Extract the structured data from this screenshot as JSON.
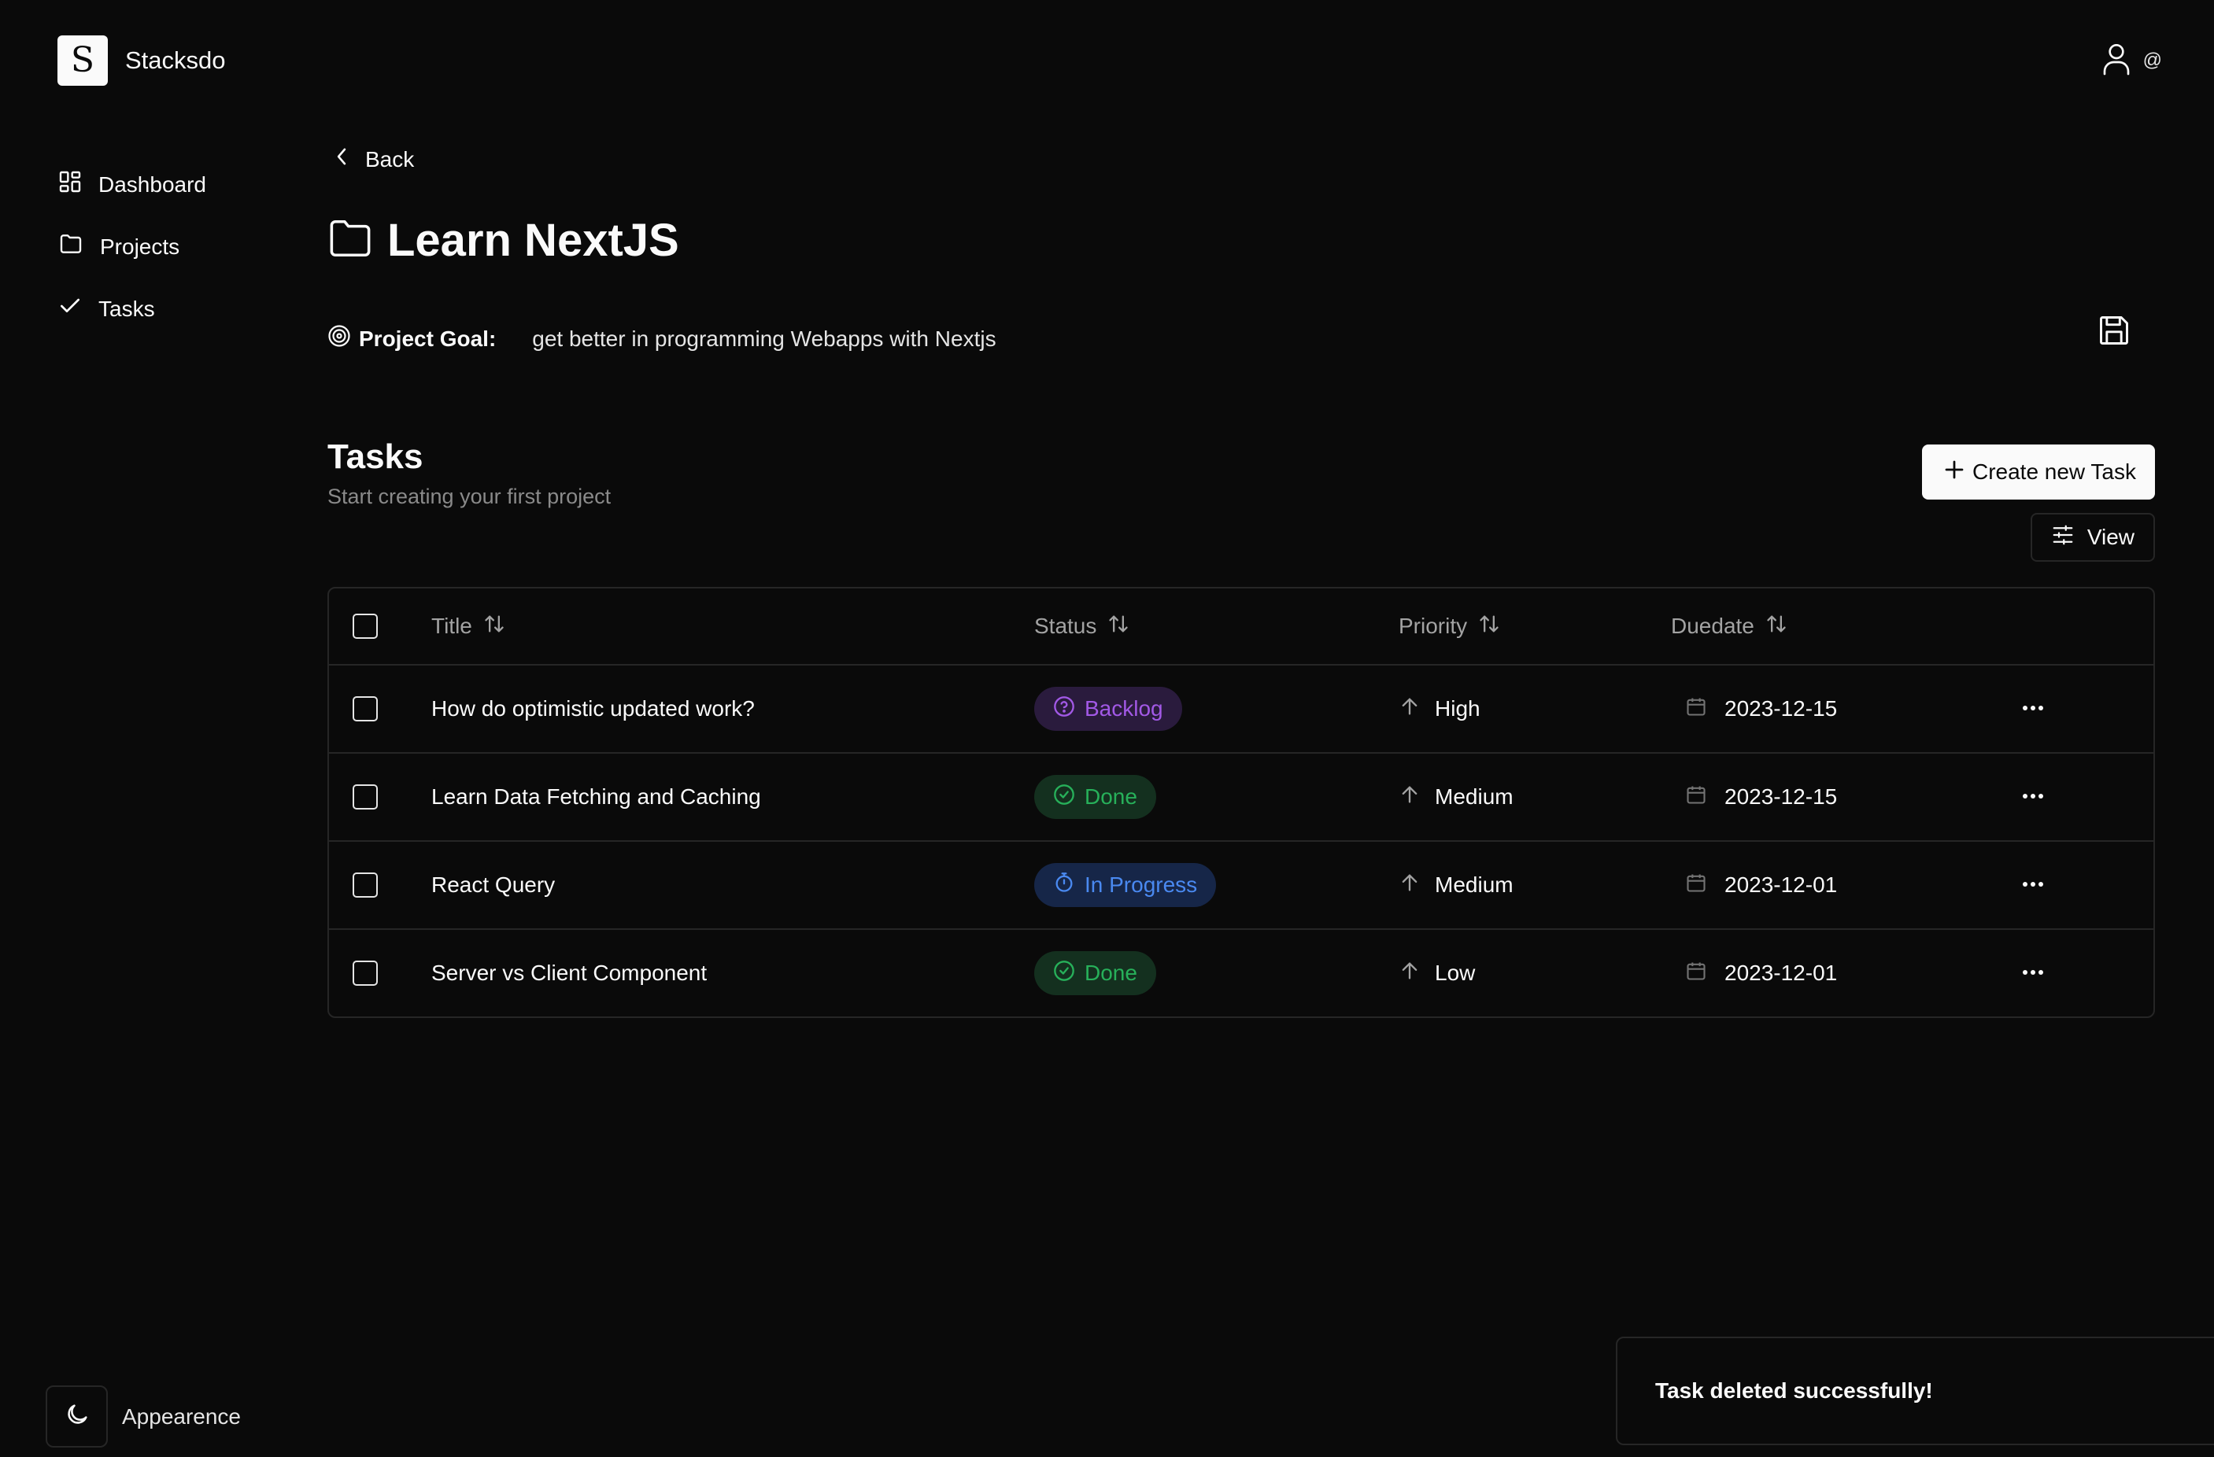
{
  "app": {
    "logo_letter": "S",
    "name": "Stacksdo"
  },
  "user": {
    "at_label": "@"
  },
  "sidebar": {
    "items": [
      {
        "label": "Dashboard",
        "icon": "dashboard-icon"
      },
      {
        "label": "Projects",
        "icon": "folder-icon"
      },
      {
        "label": "Tasks",
        "icon": "check-icon"
      }
    ],
    "appearance_label": "Appearence"
  },
  "main": {
    "back_label": "Back",
    "project_title": "Learn NextJS",
    "goal_label": "Project Goal:",
    "goal_value": "get better in programming Webapps with Nextjs",
    "tasks_title": "Tasks",
    "tasks_subtitle": "Start creating your first project",
    "create_button": "Create new Task",
    "view_button": "View"
  },
  "table": {
    "columns": {
      "title": "Title",
      "status": "Status",
      "priority": "Priority",
      "duedate": "Duedate"
    },
    "rows": [
      {
        "title": "How do optimistic updated work?",
        "status": "Backlog",
        "status_kind": "backlog",
        "priority": "High",
        "due": "2023-12-15"
      },
      {
        "title": "Learn Data Fetching and Caching",
        "status": "Done",
        "status_kind": "done",
        "priority": "Medium",
        "due": "2023-12-15"
      },
      {
        "title": "React Query",
        "status": "In Progress",
        "status_kind": "progress",
        "priority": "Medium",
        "due": "2023-12-01"
      },
      {
        "title": "Server vs Client Component",
        "status": "Done",
        "status_kind": "done",
        "priority": "Low",
        "due": "2023-12-01"
      }
    ]
  },
  "toast": {
    "message": "Task deleted successfully!"
  },
  "colors": {
    "background": "#0a0a0a",
    "border": "#262626",
    "backlog": "#a259e6",
    "done": "#27b05a",
    "in_progress": "#4a89f0"
  }
}
